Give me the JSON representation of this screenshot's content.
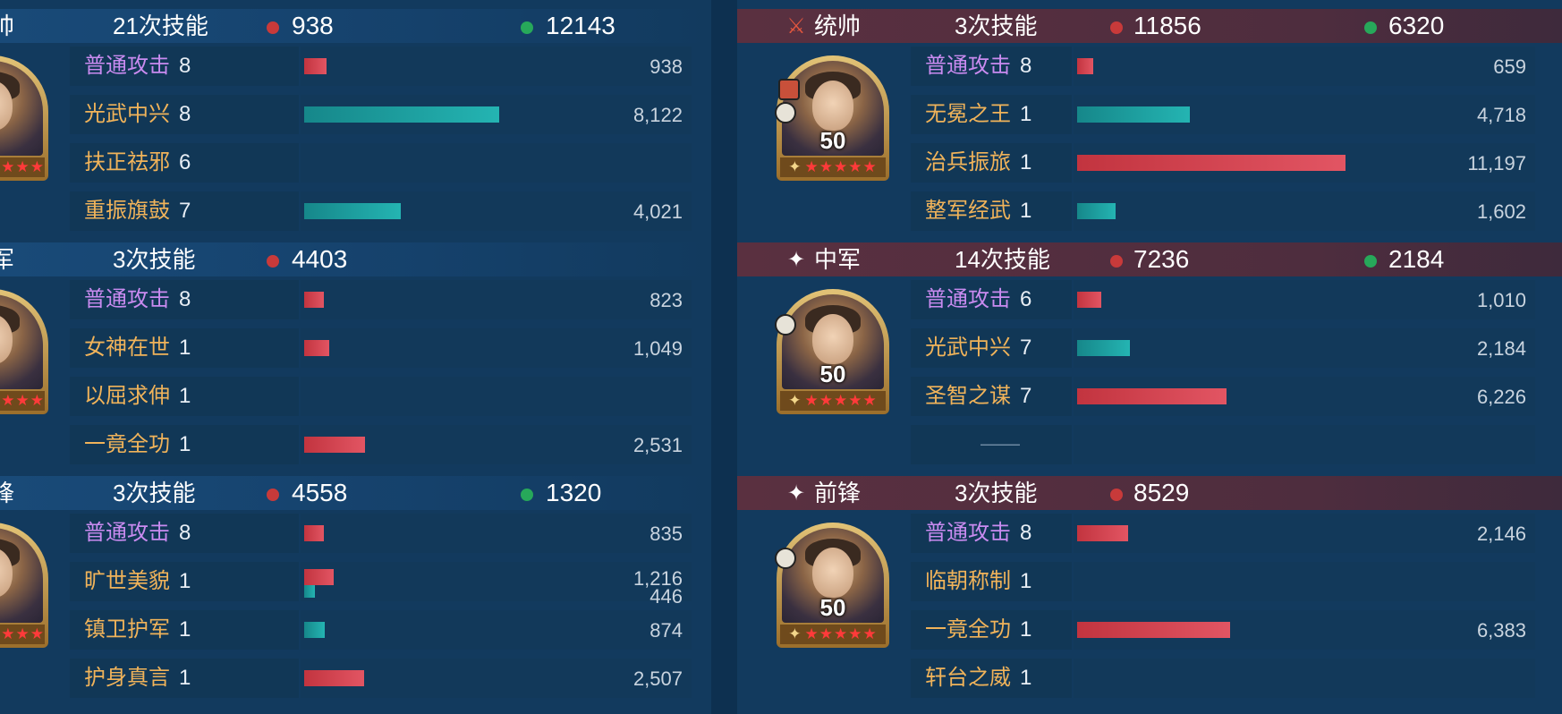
{
  "left": {
    "sections": [
      {
        "role": "帅",
        "skill_count": "21次技能",
        "damage": "938",
        "heal": "12143",
        "rows": [
          {
            "skill": "普通攻击",
            "level": "8",
            "value": "938",
            "bar": "red",
            "amount": 938,
            "attack": true
          },
          {
            "skill": "光武中兴",
            "level": "8",
            "value": "8,122",
            "bar": "teal",
            "amount": 8122
          },
          {
            "skill": "扶正祛邪",
            "level": "6",
            "value": "",
            "bar": "",
            "amount": 0
          },
          {
            "skill": "重振旗鼓",
            "level": "7",
            "value": "4,021",
            "bar": "teal",
            "amount": 4021
          }
        ]
      },
      {
        "role": "军",
        "skill_count": "3次技能",
        "damage": "4403",
        "heal": "",
        "rows": [
          {
            "skill": "普通攻击",
            "level": "8",
            "value": "823",
            "bar": "red",
            "amount": 823,
            "attack": true
          },
          {
            "skill": "女神在世",
            "level": "1",
            "value": "1,049",
            "bar": "red",
            "amount": 1049
          },
          {
            "skill": "以屈求伸",
            "level": "1",
            "value": "",
            "bar": "",
            "amount": 0
          },
          {
            "skill": "一竟全功",
            "level": "1",
            "value": "2,531",
            "bar": "red",
            "amount": 2531
          }
        ]
      },
      {
        "role": "锋",
        "skill_count": "3次技能",
        "damage": "4558",
        "heal": "1320",
        "rows": [
          {
            "skill": "普通攻击",
            "level": "8",
            "value": "835",
            "bar": "red",
            "amount": 835,
            "attack": true
          },
          {
            "skill": "旷世美貌",
            "level": "1",
            "value": "1,216",
            "value2": "446",
            "bar": "red",
            "amount": 1216,
            "bar2": "teal",
            "amount2": 446
          },
          {
            "skill": "镇卫护军",
            "level": "1",
            "value": "874",
            "bar": "teal",
            "amount": 874
          },
          {
            "skill": "护身真言",
            "level": "1",
            "value": "2,507",
            "bar": "red",
            "amount": 2507
          }
        ]
      }
    ]
  },
  "right": {
    "sections": [
      {
        "role": "统帅",
        "role_icon": "sword-badge-icon",
        "skill_count": "3次技能",
        "damage": "11856",
        "heal": "6320",
        "hero_level": "50",
        "stars": "★★★★★",
        "rows": [
          {
            "skill": "普通攻击",
            "level": "8",
            "value": "659",
            "bar": "red",
            "amount": 659,
            "attack": true
          },
          {
            "skill": "无冕之王",
            "level": "1",
            "value": "4,718",
            "bar": "teal",
            "amount": 4718
          },
          {
            "skill": "治兵振旅",
            "level": "1",
            "value": "11,197",
            "bar": "red",
            "amount": 11197
          },
          {
            "skill": "整军经武",
            "level": "1",
            "value": "1,602",
            "bar": "teal",
            "amount": 1602
          }
        ]
      },
      {
        "role": "中军",
        "role_icon": "sparkle-icon",
        "skill_count": "14次技能",
        "damage": "7236",
        "heal": "2184",
        "hero_level": "50",
        "stars": "★★★★★",
        "rows": [
          {
            "skill": "普通攻击",
            "level": "6",
            "value": "1,010",
            "bar": "red",
            "amount": 1010,
            "attack": true
          },
          {
            "skill": "光武中兴",
            "level": "7",
            "value": "2,184",
            "bar": "teal",
            "amount": 2184
          },
          {
            "skill": "圣智之谋",
            "level": "7",
            "value": "6,226",
            "bar": "red",
            "amount": 6226
          },
          {
            "skill": "",
            "level": "",
            "value": "",
            "bar": "",
            "amount": 0,
            "placeholder": "——"
          }
        ]
      },
      {
        "role": "前锋",
        "role_icon": "sparkle-icon",
        "skill_count": "3次技能",
        "damage": "8529",
        "heal": "",
        "hero_level": "50",
        "stars": "★★★★★",
        "rows": [
          {
            "skill": "普通攻击",
            "level": "8",
            "value": "2,146",
            "bar": "red",
            "amount": 2146,
            "attack": true
          },
          {
            "skill": "临朝称制",
            "level": "1",
            "value": "",
            "bar": "",
            "amount": 0
          },
          {
            "skill": "一竟全功",
            "level": "1",
            "value": "6,383",
            "bar": "red",
            "amount": 6383
          },
          {
            "skill": "轩台之威",
            "level": "1",
            "value": "",
            "bar": "",
            "amount": 0
          }
        ]
      }
    ]
  },
  "left_partial_stars": "★★★",
  "colors": {
    "damage": "#c83a3a",
    "heal": "#27a85a",
    "skill": "#f0b35a",
    "attack": "#c98bf0"
  }
}
